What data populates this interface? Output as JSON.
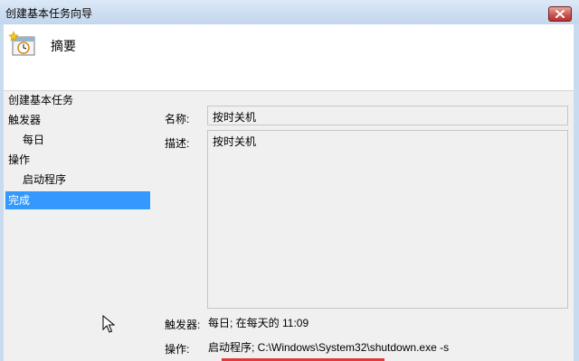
{
  "window": {
    "title": "创建基本任务向导"
  },
  "header": {
    "icon": "task-clock-icon",
    "title": "摘要"
  },
  "nav": {
    "items": [
      {
        "label": "创建基本任务",
        "selected": false
      },
      {
        "label": "触发器",
        "selected": false
      },
      {
        "label": "每日",
        "selected": false
      },
      {
        "label": "操作",
        "selected": false
      },
      {
        "label": "启动程序",
        "selected": false
      },
      {
        "label": "完成",
        "selected": true
      }
    ]
  },
  "summary": {
    "name_label": "名称:",
    "name_value": "按时关机",
    "desc_label": "描述:",
    "desc_value": "按时关机",
    "trigger_label": "触发器:",
    "trigger_value": "每日; 在每天的 11:09",
    "action_label": "操作:",
    "action_value": "启动程序; C:\\Windows\\System32\\shutdown.exe -s"
  },
  "colors": {
    "selection": "#3399ff",
    "close_button": "#c75050",
    "frame": "#c9dcef"
  }
}
